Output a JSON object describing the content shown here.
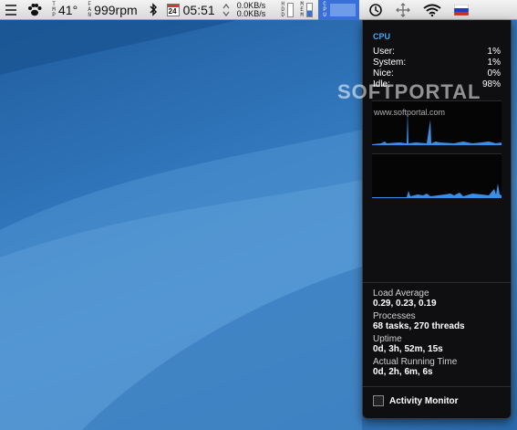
{
  "menubar": {
    "temp_label": "TMP",
    "temp_value": "41°",
    "fan_label": "FAN",
    "fan_value": "999rpm",
    "calendar_day": "24",
    "time": "05:51",
    "net_up": "0.0KB/s",
    "net_down": "0.0KB/s",
    "hdd_label": "HDD",
    "mem_label": "MEM",
    "cpu_label": "CPU"
  },
  "panel": {
    "title": "CPU",
    "stats": [
      {
        "label": "User:",
        "value": "1%"
      },
      {
        "label": "System:",
        "value": "1%"
      },
      {
        "label": "Nice:",
        "value": "0%"
      },
      {
        "label": "Idle:",
        "value": "98%"
      }
    ],
    "load_average_label": "Load Average",
    "load_average_value": "0.29, 0.23, 0.19",
    "processes_label": "Processes",
    "processes_value": "68 tasks, 270 threads",
    "uptime_label": "Uptime",
    "uptime_value": "0d, 3h, 52m, 15s",
    "running_label": "Actual Running Time",
    "running_value": "0d, 2h, 6m, 6s",
    "activity_monitor": "Activity Monitor"
  },
  "watermark": {
    "title": "SOFTPORTAL",
    "url": "www.softportal.com"
  },
  "colors": {
    "accent": "#3fa9f5",
    "graph_line": "#3a8ee6",
    "menu_highlight": "#3a6fd8"
  }
}
